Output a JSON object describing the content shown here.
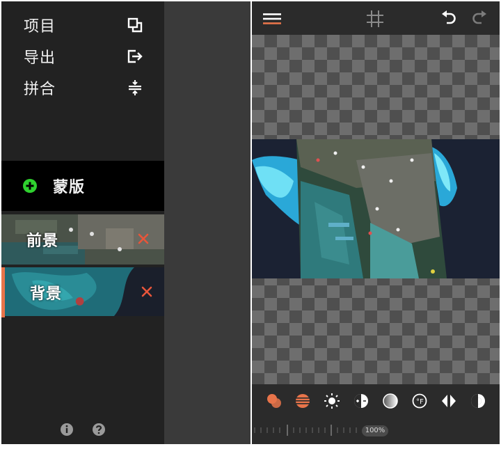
{
  "menu": {
    "items": [
      {
        "label": "项目",
        "icon": "project-icon"
      },
      {
        "label": "导出",
        "icon": "export-icon"
      },
      {
        "label": "拼合",
        "icon": "flatten-icon"
      }
    ]
  },
  "mask": {
    "label": "蒙版",
    "icon": "add-circle-icon",
    "color": "#2fd12f"
  },
  "layers": [
    {
      "label": "前景",
      "active": false
    },
    {
      "label": "背景",
      "active": true
    }
  ],
  "footer": {
    "icons": [
      "info-icon",
      "help-icon"
    ]
  },
  "toolbar": {
    "icons": [
      "hamburger-menu-icon",
      "grid-icon",
      "undo-icon",
      "redo-icon"
    ]
  },
  "bottom_tools": {
    "icons": [
      "blend-icon",
      "gradient-icon",
      "brightness-icon",
      "exposure-icon",
      "contrast-icon",
      "temperature-icon",
      "flip-icon",
      "invert-icon"
    ]
  },
  "zoom": {
    "label": "100%"
  },
  "colors": {
    "accent": "#e8744a",
    "delete": "#e8553a",
    "add": "#2fd12f"
  }
}
